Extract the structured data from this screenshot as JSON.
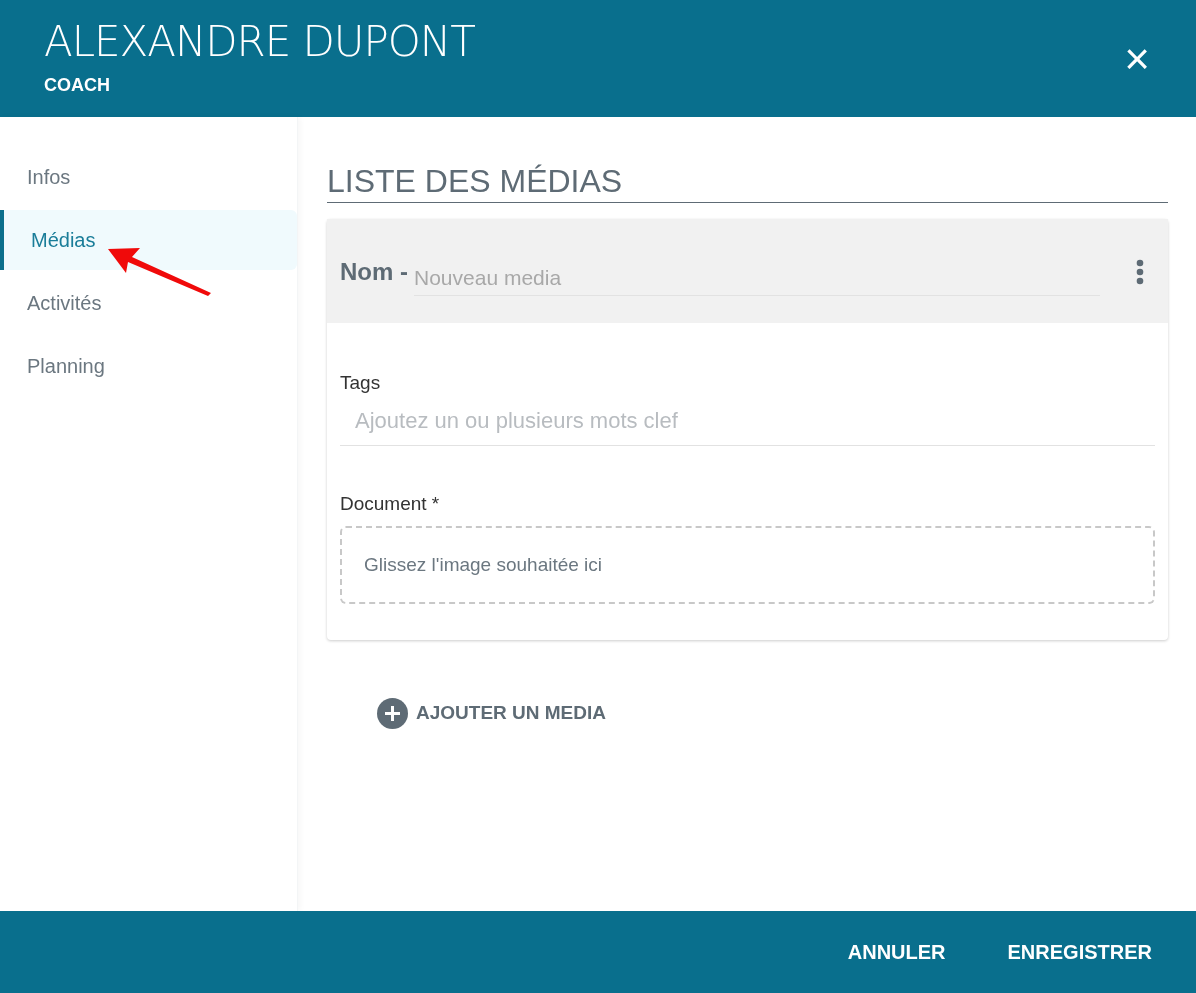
{
  "header": {
    "title": "ALEXANDRE DUPONT",
    "subtitle": "COACH",
    "close": "×"
  },
  "sidebar": {
    "items": [
      {
        "label": "Infos",
        "selected": false
      },
      {
        "label": "Médias",
        "selected": true
      },
      {
        "label": "Activités",
        "selected": false
      },
      {
        "label": "Planning",
        "selected": false
      }
    ]
  },
  "section_title": "LISTE DES MÉDIAS",
  "media_card": {
    "name_label": "Nom -",
    "name_placeholder": "Nouveau media",
    "tags_label": "Tags",
    "tags_placeholder": "Ajoutez un ou plusieurs mots clef",
    "document_label": "Document *",
    "dropzone_text": "Glissez l'image souhaitée ici"
  },
  "add_button": "AJOUTER UN MEDIA",
  "footer": {
    "buttons": [
      "ANNULER",
      "ENREGISTRER"
    ]
  }
}
